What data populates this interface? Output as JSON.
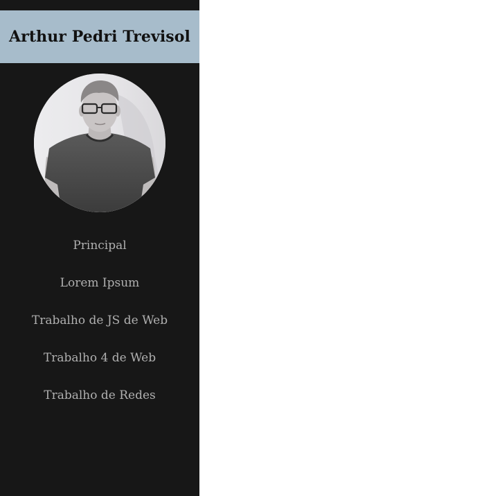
{
  "site": {
    "title": "Arthur Pedri Trevisol"
  },
  "avatar": {
    "icon": "profile-photo"
  },
  "nav": {
    "items": [
      {
        "label": "Principal"
      },
      {
        "label": "Lorem Ipsum"
      },
      {
        "label": "Trabalho de JS de Web"
      },
      {
        "label": "Trabalho 4 de Web"
      },
      {
        "label": "Trabalho de Redes"
      }
    ]
  },
  "colors": {
    "sidebar_bg": "#171717",
    "header_bg": "#a7bccb",
    "nav_text": "#b0b0b0",
    "title_text": "#111111",
    "main_bg": "#ffffff"
  }
}
